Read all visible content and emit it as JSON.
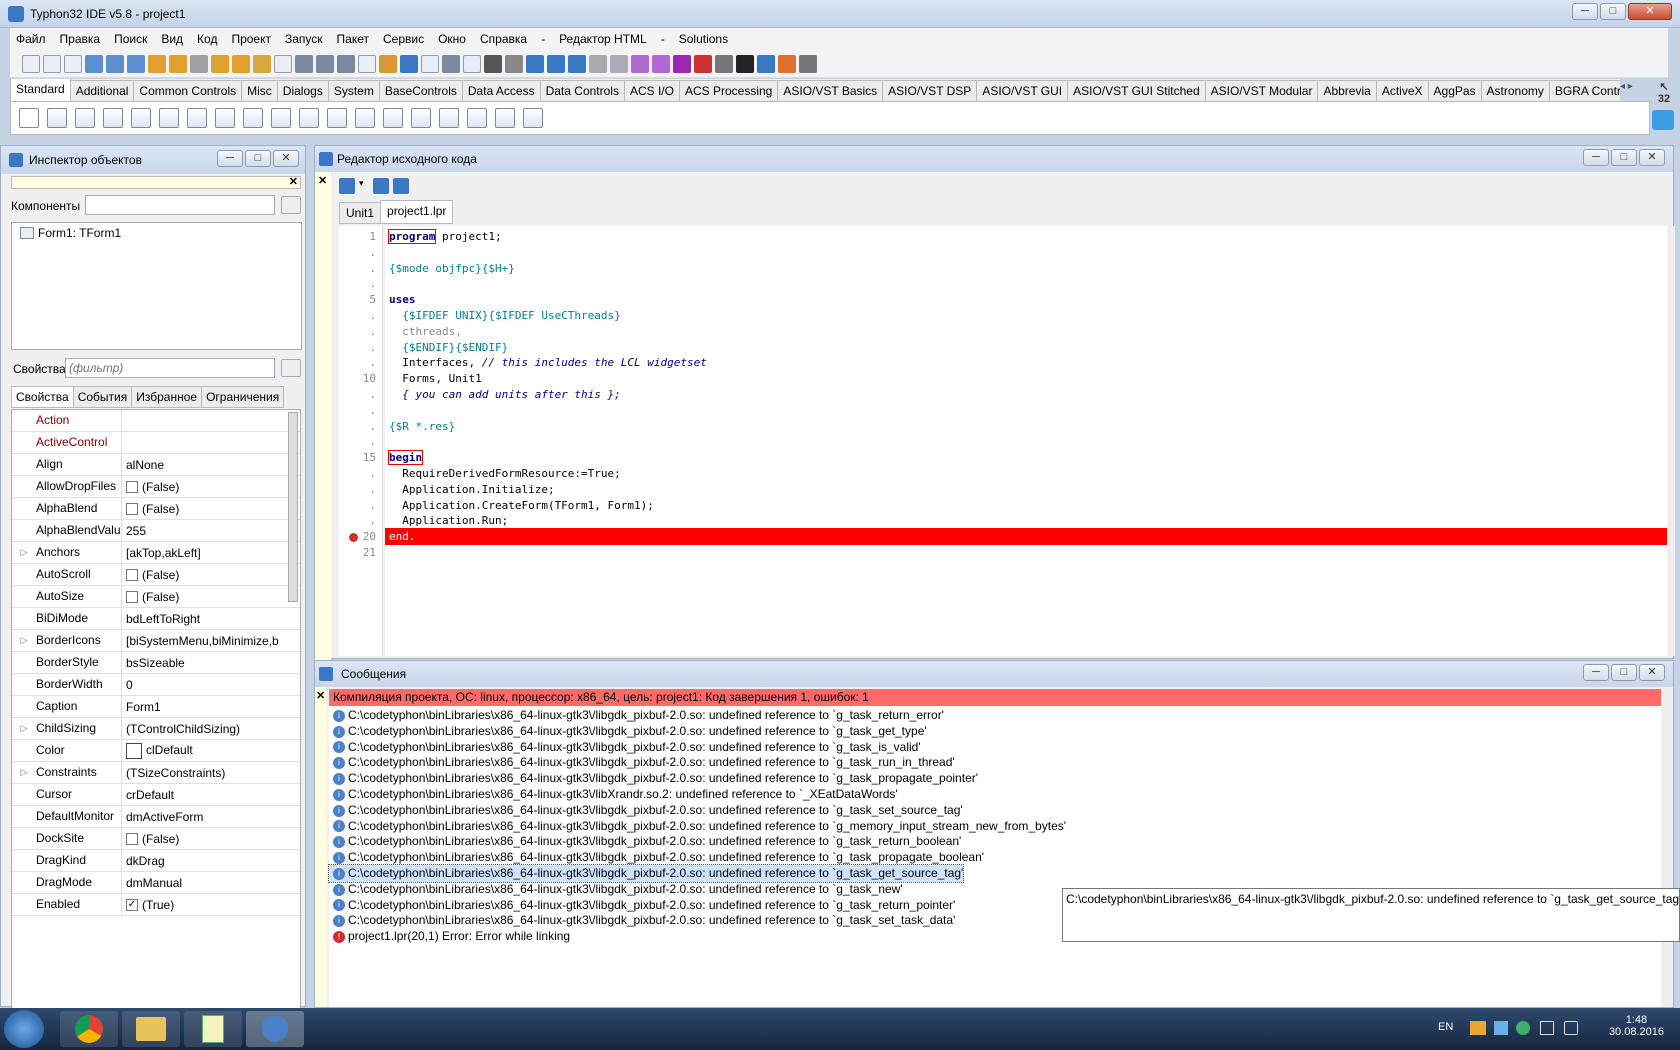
{
  "window": {
    "title": "Typhon32 IDE v5.8 - project1"
  },
  "menu": [
    "Файл",
    "Правка",
    "Поиск",
    "Вид",
    "Код",
    "Проект",
    "Запуск",
    "Пакет",
    "Сервис",
    "Окно",
    "Справка",
    "-",
    "Редактор HTML",
    "-",
    "Solutions"
  ],
  "palette": {
    "tabs": [
      "Standard",
      "Additional",
      "Common Controls",
      "Misc",
      "Dialogs",
      "System",
      "BaseControls",
      "Data Access",
      "Data Controls",
      "ACS I/O",
      "ACS Processing",
      "ASIO/VST Basics",
      "ASIO/VST DSP",
      "ASIO/VST GUI",
      "ASIO/VST GUI Stitched",
      "ASIO/VST Modular",
      "Abbrevia",
      "ActiveX",
      "AggPas",
      "Astronomy",
      "BGRA Control"
    ],
    "count": "32"
  },
  "inspector": {
    "title": "Инспектор объектов",
    "components_label": "Компоненты",
    "tree_item": "Form1: TForm1",
    "props_label": "Свойства",
    "filter_placeholder": "(фильтр)",
    "tabs": [
      "Свойства",
      "События",
      "Избранное",
      "Ограничения"
    ],
    "properties": [
      {
        "name": "Action",
        "value": "",
        "red": true
      },
      {
        "name": "ActiveControl",
        "value": "",
        "red": true
      },
      {
        "name": "Align",
        "value": "alNone"
      },
      {
        "name": "AllowDropFiles",
        "value": "(False)",
        "check": true
      },
      {
        "name": "AlphaBlend",
        "value": "(False)",
        "check": true
      },
      {
        "name": "AlphaBlendValu",
        "value": "255"
      },
      {
        "name": "Anchors",
        "value": "[akTop,akLeft]",
        "expand": true
      },
      {
        "name": "AutoScroll",
        "value": "(False)",
        "check": true
      },
      {
        "name": "AutoSize",
        "value": "(False)",
        "check": true
      },
      {
        "name": "BiDiMode",
        "value": "bdLeftToRight"
      },
      {
        "name": "BorderIcons",
        "value": "[biSystemMenu,biMinimize,b",
        "expand": true
      },
      {
        "name": "BorderStyle",
        "value": "bsSizeable"
      },
      {
        "name": "BorderWidth",
        "value": "0"
      },
      {
        "name": "Caption",
        "value": "Form1"
      },
      {
        "name": "ChildSizing",
        "value": "(TControlChildSizing)",
        "expand": true
      },
      {
        "name": "Color",
        "value": "clDefault",
        "swatch": true
      },
      {
        "name": "Constraints",
        "value": "(TSizeConstraints)",
        "expand": true
      },
      {
        "name": "Cursor",
        "value": "crDefault"
      },
      {
        "name": "DefaultMonitor",
        "value": "dmActiveForm"
      },
      {
        "name": "DockSite",
        "value": "(False)",
        "check": true
      },
      {
        "name": "DragKind",
        "value": "dkDrag"
      },
      {
        "name": "DragMode",
        "value": "dmManual"
      },
      {
        "name": "Enabled",
        "value": "(True)",
        "check": true,
        "checked": true
      }
    ]
  },
  "editor": {
    "title": "Редактор исходного кода",
    "tabs": [
      "Unit1",
      "project1.lpr"
    ],
    "line_numbers": [
      "1",
      ".",
      ".",
      ".",
      "5",
      ".",
      ".",
      ".",
      ".",
      "10",
      ".",
      ".",
      ".",
      ".",
      "15",
      ".",
      ".",
      ".",
      ".",
      "20",
      "21"
    ],
    "lines": [
      "program project1;",
      "",
      "{$mode objfpc}{$H+}",
      "",
      "uses",
      "  {$IFDEF UNIX}{$IFDEF UseCThreads}",
      "  cthreads,",
      "  {$ENDIF}{$ENDIF}",
      "  Interfaces, // this includes the LCL widgetset",
      "  Forms, Unit1",
      "  { you can add units after this };",
      "",
      "{$R *.res}",
      "",
      "begin",
      "  RequireDerivedFormResource:=True;",
      "  Application.Initialize;",
      "  Application.CreateForm(TForm1, Form1);",
      "  Application.Run;",
      "end.",
      ""
    ]
  },
  "messages": {
    "title": "Сообщения",
    "header": "Компиляция проекта, ОС: linux, процессор: x86_64, цель: project1: Код завершения 1, ошибок: 1",
    "items": [
      "C:\\codetyphon\\binLibraries\\x86_64-linux-gtk3\\/libgdk_pixbuf-2.0.so: undefined reference to `g_task_return_error'",
      "C:\\codetyphon\\binLibraries\\x86_64-linux-gtk3\\/libgdk_pixbuf-2.0.so: undefined reference to `g_task_get_type'",
      "C:\\codetyphon\\binLibraries\\x86_64-linux-gtk3\\/libgdk_pixbuf-2.0.so: undefined reference to `g_task_is_valid'",
      "C:\\codetyphon\\binLibraries\\x86_64-linux-gtk3\\/libgdk_pixbuf-2.0.so: undefined reference to `g_task_run_in_thread'",
      "C:\\codetyphon\\binLibraries\\x86_64-linux-gtk3\\/libgdk_pixbuf-2.0.so: undefined reference to `g_task_propagate_pointer'",
      "C:\\codetyphon\\binLibraries\\x86_64-linux-gtk3\\/libXrandr.so.2: undefined reference to `_XEatDataWords'",
      "C:\\codetyphon\\binLibraries\\x86_64-linux-gtk3\\/libgdk_pixbuf-2.0.so: undefined reference to `g_task_set_source_tag'",
      "C:\\codetyphon\\binLibraries\\x86_64-linux-gtk3\\/libgdk_pixbuf-2.0.so: undefined reference to `g_memory_input_stream_new_from_bytes'",
      "C:\\codetyphon\\binLibraries\\x86_64-linux-gtk3\\/libgdk_pixbuf-2.0.so: undefined reference to `g_task_return_boolean'",
      "C:\\codetyphon\\binLibraries\\x86_64-linux-gtk3\\/libgdk_pixbuf-2.0.so: undefined reference to `g_task_propagate_boolean'",
      "C:\\codetyphon\\binLibraries\\x86_64-linux-gtk3\\/libgdk_pixbuf-2.0.so: undefined reference to `g_task_get_source_tag'",
      "C:\\codetyphon\\binLibraries\\x86_64-linux-gtk3\\/libgdk_pixbuf-2.0.so: undefined reference to `g_task_new'",
      "C:\\codetyphon\\binLibraries\\x86_64-linux-gtk3\\/libgdk_pixbuf-2.0.so: undefined reference to `g_task_return_pointer'",
      "C:\\codetyphon\\binLibraries\\x86_64-linux-gtk3\\/libgdk_pixbuf-2.0.so: undefined reference to `g_task_set_task_data'"
    ],
    "error": "project1.lpr(20,1) Error: Error while linking",
    "tooltip": "C:\\codetyphon\\binLibraries\\x86_64-linux-gtk3\\/libgdk_pixbuf-2.0.so: undefined reference to `g_task_get_source_tag'"
  },
  "taskbar": {
    "lang": "EN",
    "time": "1:48",
    "date": "30.08.2016"
  },
  "colors": {
    "error_line": "#ff0000",
    "error_header": "#ff6b6b",
    "title_bar": "#c9d7ea"
  }
}
